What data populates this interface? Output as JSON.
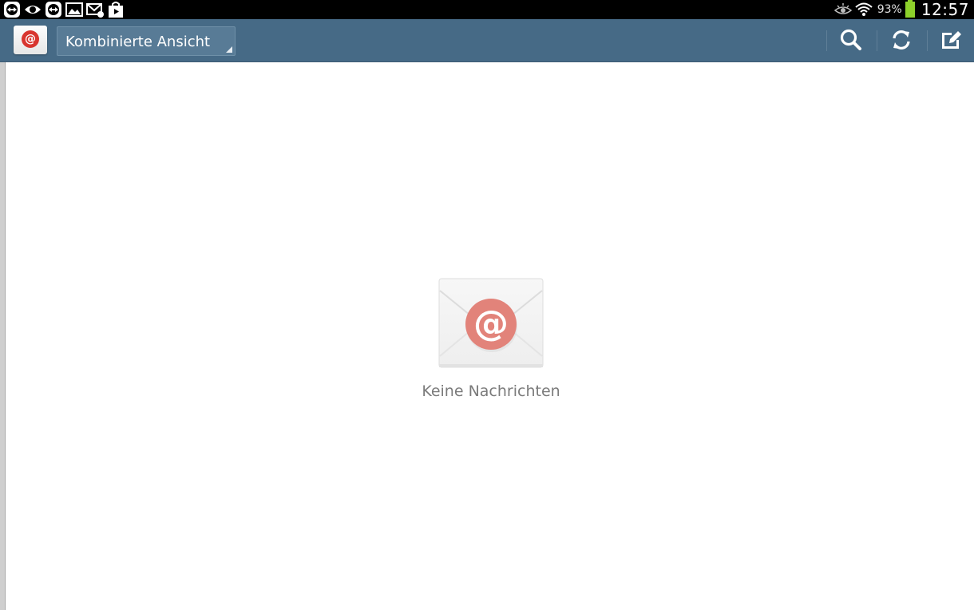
{
  "status_bar": {
    "notification_icons": [
      "teamviewer-icon",
      "eye-icon",
      "teamviewer-icon",
      "gallery-icon",
      "email-icon",
      "shopping-bag-icon"
    ],
    "battery_percent": "93%",
    "battery_level": 0.93,
    "time": "12:57"
  },
  "action_bar": {
    "app_icon": "email-app-icon",
    "view_selector": "Kombinierte Ansicht",
    "actions": [
      "search-icon",
      "refresh-icon",
      "compose-icon"
    ]
  },
  "empty_state": {
    "icon": "envelope-at-icon",
    "message": "Keine Nachrichten"
  },
  "colors": {
    "action_bar": "#466a86",
    "accent_red": "#d8352f",
    "battery": "#8ed12b",
    "message_text": "#7b7b7b"
  }
}
